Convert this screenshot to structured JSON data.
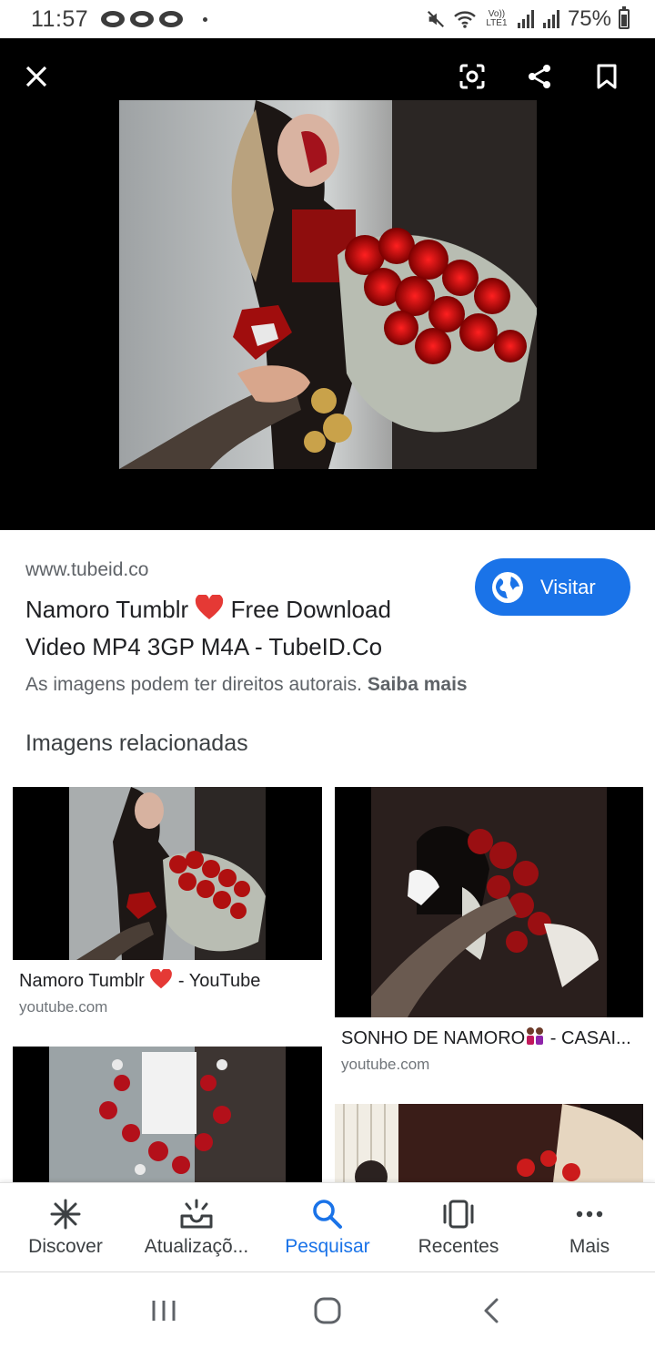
{
  "status_bar": {
    "time": "11:57",
    "network_label": "Vo)) LTE1",
    "battery_percent": "75%"
  },
  "viewer": {
    "close_icon": "close-icon",
    "lens_icon": "lens-icon",
    "share_icon": "share-icon",
    "bookmark_icon": "bookmark-icon"
  },
  "result": {
    "source_url": "www.tubeid.co",
    "title_part1": "Namoro Tumblr ",
    "title_part2": " Free Download Video MP4 3GP M4A - TubeID.Co",
    "visit_label": "Visitar",
    "copyright_text": "As imagens podem ter direitos autorais.",
    "learn_more": "Saiba mais"
  },
  "related": {
    "heading": "Imagens relacionadas",
    "items": [
      {
        "title_a": "Namoro Tumblr ",
        "title_b": " - YouTube",
        "domain": "youtube.com"
      },
      {
        "title_a": "SONHO DE NAMORO",
        "title_b": " - CASAI...",
        "domain": "youtube.com"
      }
    ]
  },
  "bottom_nav": {
    "items": [
      {
        "label": "Discover",
        "icon": "asterisk-icon"
      },
      {
        "label": "Atualizaçõ...",
        "icon": "updates-icon"
      },
      {
        "label": "Pesquisar",
        "icon": "search-icon"
      },
      {
        "label": "Recentes",
        "icon": "recents-icon"
      },
      {
        "label": "Mais",
        "icon": "more-icon"
      }
    ],
    "active_index": 2
  },
  "colors": {
    "accent": "#1a73e8",
    "heart": "#e53935"
  }
}
